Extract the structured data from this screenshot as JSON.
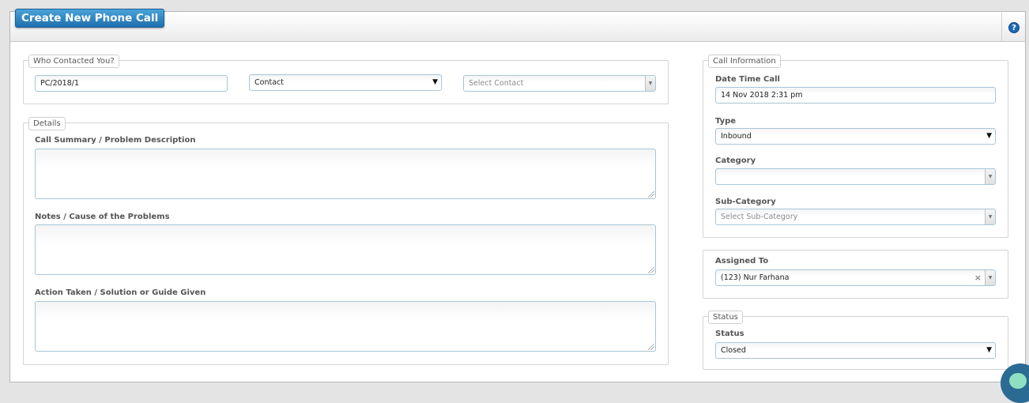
{
  "header": {
    "title": "Create New Phone Call",
    "help_icon": "question-circle-icon"
  },
  "who_contacted": {
    "legend": "Who Contacted You?",
    "reference": "PC/2018/1",
    "contact_type": "Contact",
    "contact_placeholder": "Select Contact"
  },
  "details": {
    "legend": "Details",
    "call_summary_label": "Call Summary / Problem Description",
    "notes_label": "Notes / Cause of the Problems",
    "action_label": "Action Taken / Solution or Guide Given"
  },
  "call_information": {
    "legend": "Call Information",
    "date_time_label": "Date Time Call",
    "date_time_value": "14 Nov 2018 2:31 pm",
    "type_label": "Type",
    "type_value": "Inbound",
    "category_label": "Category",
    "category_value": "",
    "sub_category_label": "Sub-Category",
    "sub_category_placeholder": "Select Sub-Category"
  },
  "assignment": {
    "assigned_to_label": "Assigned To",
    "assigned_to_value": "(123) Nur Farhana"
  },
  "status": {
    "legend": "Status",
    "status_label": "Status",
    "status_value": "Closed"
  },
  "colors": {
    "title_button": "#1f6fae",
    "field_border": "#a8c5d8",
    "help_icon": "#1f68b3",
    "chat_bubble": "#2b6a93"
  }
}
